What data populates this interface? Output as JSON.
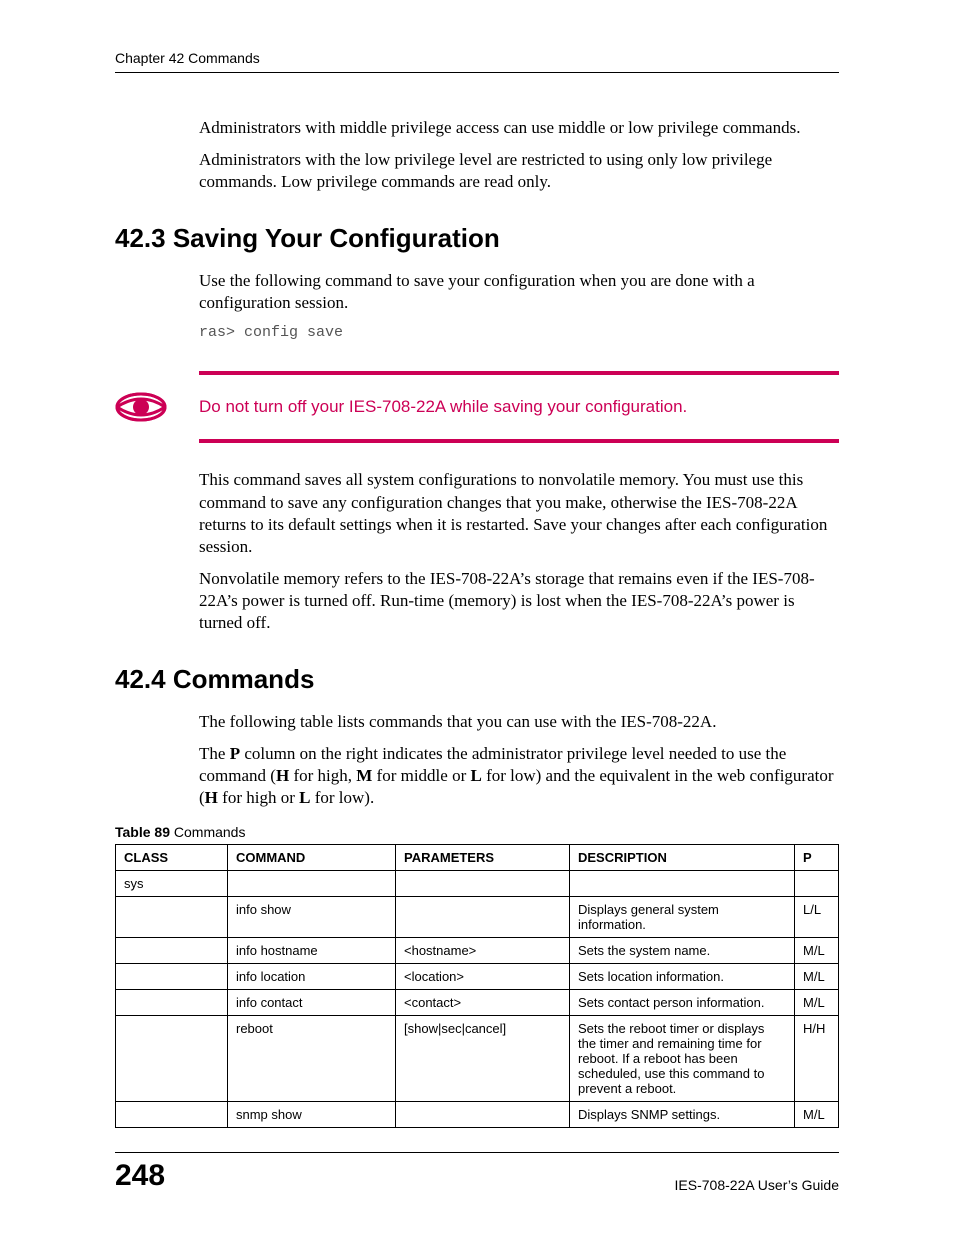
{
  "header": {
    "chapter": "Chapter 42 Commands"
  },
  "intro": {
    "p1": "Administrators with middle privilege access can use middle or low privilege commands.",
    "p2": "Administrators with the low privilege level are restricted to using only low privilege commands. Low privilege commands are read only."
  },
  "section1": {
    "title": "42.3  Saving Your Configuration",
    "p1": "Use the following command to save your configuration when you are done with a configuration session.",
    "code": "ras> config save",
    "warning": "Do not turn off your IES-708-22A while saving your configuration.",
    "p2": "This command saves all system configurations to nonvolatile memory. You must use this command to save any configuration changes that you make, otherwise the IES-708-22A returns to its default settings when it is restarted. Save your changes after each configuration session.",
    "p3": "Nonvolatile memory refers to the IES-708-22A’s storage that remains even if the IES-708-22A’s power is turned off. Run-time (memory) is lost when the IES-708-22A’s power is turned off."
  },
  "section2": {
    "title": "42.4  Commands",
    "p1": "The following table lists commands that you can use with the IES-708-22A.",
    "p2_pre": "The ",
    "p2_b1": "P",
    "p2_mid1": " column on the right indicates the administrator privilege level needed to use the command (",
    "p2_b2": "H",
    "p2_mid2": " for high, ",
    "p2_b3": "M",
    "p2_mid3": " for middle or ",
    "p2_b4": "L",
    "p2_mid4": " for low) and the equivalent in the web configurator (",
    "p2_b5": "H",
    "p2_mid5": " for high or ",
    "p2_b6": "L",
    "p2_post": " for low)."
  },
  "table": {
    "caption_label": "Table 89",
    "caption_text": "   Commands",
    "headers": {
      "class": "CLASS",
      "command": "COMMAND",
      "parameters": "PARAMETERS",
      "description": "DESCRIPTION",
      "p": "P"
    },
    "rows": [
      {
        "class": "sys",
        "command": "",
        "parameters": "",
        "description": "",
        "p": ""
      },
      {
        "class": "",
        "command": "info show",
        "parameters": "",
        "description": "Displays general system information.",
        "p": "L/L"
      },
      {
        "class": "",
        "command": "info hostname",
        "parameters": "<hostname>",
        "description": "Sets the system name.",
        "p": "M/L"
      },
      {
        "class": "",
        "command": "info location",
        "parameters": "<location>",
        "description": "Sets location information.",
        "p": "M/L"
      },
      {
        "class": "",
        "command": "info contact",
        "parameters": "<contact>",
        "description": "Sets contact person information.",
        "p": "M/L"
      },
      {
        "class": "",
        "command": "reboot",
        "parameters": "[show|sec|cancel]",
        "description": "Sets the reboot timer or displays the timer and remaining time for reboot. If a reboot has been scheduled, use this command to prevent a reboot.",
        "p": "H/H"
      },
      {
        "class": "",
        "command": "snmp show",
        "parameters": "",
        "description": "Displays SNMP settings.",
        "p": "M/L"
      }
    ]
  },
  "footer": {
    "page": "248",
    "doc": "IES-708-22A User’s Guide"
  }
}
